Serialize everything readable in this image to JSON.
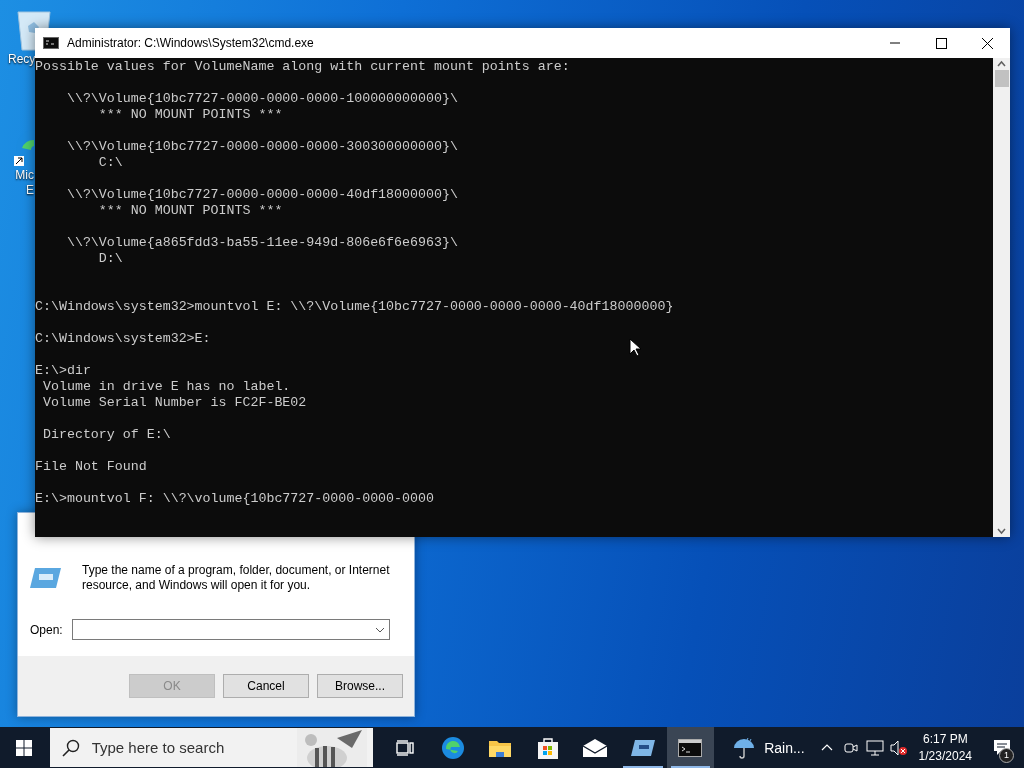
{
  "desktop_icons": [
    {
      "kind": "recycle-bin",
      "label_lines": [
        "Recy"
      ]
    },
    {
      "kind": "browser",
      "label_lines": [
        "Mic",
        "E"
      ]
    }
  ],
  "console_window": {
    "title": "Administrator: C:\\Windows\\System32\\cmd.exe",
    "lines": [
      {
        "kind": "text",
        "text": "Possible values for VolumeName along with current mount points are:"
      },
      {
        "kind": "blank"
      },
      {
        "kind": "text",
        "text": "    \\\\?\\Volume{10bc7727-0000-0000-0000-100000000000}\\"
      },
      {
        "kind": "text",
        "text": "        *** NO MOUNT POINTS ***"
      },
      {
        "kind": "blank"
      },
      {
        "kind": "text",
        "text": "    \\\\?\\Volume{10bc7727-0000-0000-0000-300300000000}\\"
      },
      {
        "kind": "text",
        "text": "        C:\\"
      },
      {
        "kind": "blank"
      },
      {
        "kind": "text",
        "text": "    \\\\?\\Volume{10bc7727-0000-0000-0000-40df18000000}\\"
      },
      {
        "kind": "text",
        "text": "        *** NO MOUNT POINTS ***"
      },
      {
        "kind": "blank"
      },
      {
        "kind": "text",
        "text": "    \\\\?\\Volume{a865fdd3-ba55-11ee-949d-806e6f6e6963}\\"
      },
      {
        "kind": "text",
        "text": "        D:\\"
      },
      {
        "kind": "blank"
      },
      {
        "kind": "blank"
      },
      {
        "kind": "text",
        "text": "C:\\Windows\\system32>mountvol E: \\\\?\\Volume{10bc7727-0000-0000-0000-40df18000000}"
      },
      {
        "kind": "blank"
      },
      {
        "kind": "text",
        "text": "C:\\Windows\\system32>E:"
      },
      {
        "kind": "blank"
      },
      {
        "kind": "text",
        "text": "E:\\>dir"
      },
      {
        "kind": "text",
        "text": " Volume in drive E has no label."
      },
      {
        "kind": "text",
        "text": " Volume Serial Number is FC2F-BE02"
      },
      {
        "kind": "blank"
      },
      {
        "kind": "text",
        "text": " Directory of E:\\"
      },
      {
        "kind": "blank"
      },
      {
        "kind": "text",
        "text": "File Not Found"
      },
      {
        "kind": "blank"
      },
      {
        "kind": "text",
        "text": "E:\\>mountvol F: \\\\?\\volume{10bc7727-0000-0000-0000"
      }
    ]
  },
  "run_dialog": {
    "description": "Type the name of a program, folder, document, or Internet resource, and Windows will open it for you.",
    "open_label": "Open:",
    "buttons": [
      {
        "label": "OK",
        "disabled": true
      },
      {
        "label": "Cancel",
        "disabled": false
      },
      {
        "label": "Browse...",
        "disabled": false
      }
    ]
  },
  "taskbar": {
    "search_placeholder": "Type here to search",
    "apps": [
      {
        "kind": "task-view",
        "running": false,
        "selected": false
      },
      {
        "kind": "browser",
        "running": false,
        "selected": false
      },
      {
        "kind": "folder",
        "running": false,
        "selected": false
      },
      {
        "kind": "store",
        "running": false,
        "selected": false
      },
      {
        "kind": "mail",
        "running": false,
        "selected": false
      },
      {
        "kind": "run",
        "running": true,
        "selected": false
      },
      {
        "kind": "terminal",
        "running": true,
        "selected": true
      }
    ],
    "weather": "Rain...",
    "time": "6:17 PM",
    "date": "1/23/2024",
    "notification_count": "1"
  }
}
